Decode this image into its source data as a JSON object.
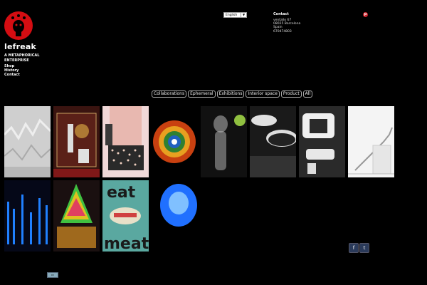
{
  "brand": {
    "name": "lefreak",
    "tagline": "A METAPHORICAL ENTERPRISE",
    "colors": {
      "logo_red": "#d40d12"
    }
  },
  "nav": [
    {
      "label": "Shop"
    },
    {
      "label": "History"
    },
    {
      "label": "Contact"
    }
  ],
  "language": {
    "selected": "English"
  },
  "contact": {
    "title": "Contact",
    "lines": [
      "ventallo 67",
      "08025 Barcelona",
      "Spain",
      "670474803"
    ]
  },
  "filters": [
    {
      "label": "Collaborations"
    },
    {
      "label": "Ephemeral"
    },
    {
      "label": "Exhibitions"
    },
    {
      "label": "Interior space"
    },
    {
      "label": "Product"
    },
    {
      "label": "All"
    }
  ],
  "gallery": [
    {
      "icon": "wall-texture-image"
    },
    {
      "icon": "shop-window-image"
    },
    {
      "icon": "fashion-dress-image"
    },
    {
      "icon": "kaleidoscope-image"
    },
    {
      "icon": "glass-figure-image"
    },
    {
      "icon": "bowls-image"
    },
    {
      "icon": "white-furniture-image"
    },
    {
      "icon": "staircase-image"
    },
    {
      "icon": "led-lights-image"
    },
    {
      "icon": "colorful-installation-image"
    },
    {
      "icon": "eat-meat-poster-image",
      "text_top": "eat",
      "text_bottom": "meat"
    },
    {
      "icon": "blue-glow-image"
    }
  ],
  "social": [
    {
      "icon": "facebook-icon",
      "glyph": "f"
    },
    {
      "icon": "twitter-icon",
      "glyph": "t"
    }
  ]
}
